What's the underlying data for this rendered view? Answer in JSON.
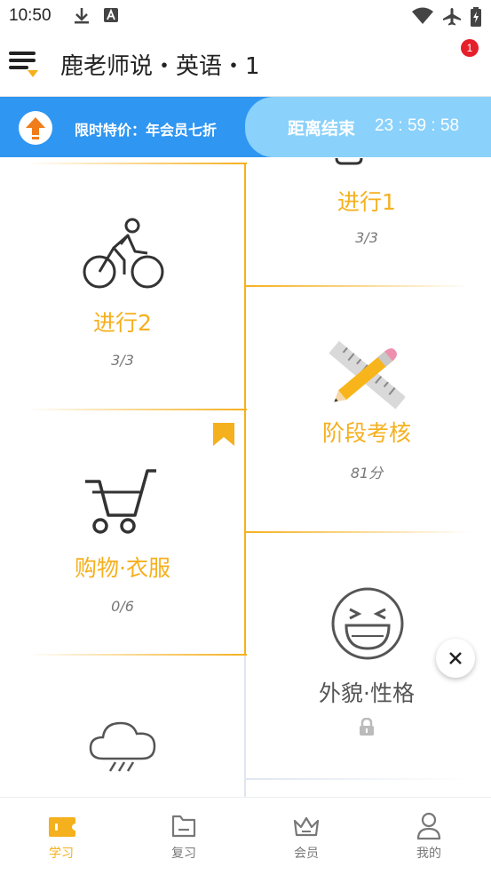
{
  "status_bar": {
    "time": "10:50"
  },
  "header": {
    "title": "鹿老师说・英语・1",
    "badge_count": "1"
  },
  "promo": {
    "label": "限时特价：年会员七折",
    "end_label": "距离结束",
    "countdown": "23 : 59 : 58"
  },
  "lessons": [
    {
      "title": "进行1",
      "progress": "3/3",
      "icon": "clipboard-icon",
      "state": "completed"
    },
    {
      "title": "进行2",
      "progress": "3/3",
      "icon": "bicycle-icon",
      "state": "completed"
    },
    {
      "title": "阶段考核",
      "progress": "81分",
      "icon": "pencil-ruler-icon",
      "state": "completed"
    },
    {
      "title": "购物·衣服",
      "progress": "0/6",
      "icon": "shopping-cart-icon",
      "state": "current",
      "bookmarked": true
    },
    {
      "title": "外貌·性格",
      "progress": "",
      "icon": "laughing-face-icon",
      "state": "locked"
    },
    {
      "title": "",
      "progress": "",
      "icon": "rain-cloud-icon",
      "state": "locked"
    }
  ],
  "tabs": [
    {
      "label": "学习",
      "icon": "ticket-icon",
      "active": true
    },
    {
      "label": "复习",
      "icon": "folder-icon",
      "active": false
    },
    {
      "label": "会员",
      "icon": "crown-icon",
      "active": false
    },
    {
      "label": "我的",
      "icon": "user-icon",
      "active": false
    }
  ],
  "colors": {
    "accent": "#f5b01e",
    "promo_blue": "#2f96f2",
    "promo_light": "#8ad1fb",
    "badge_red": "#e5202b",
    "locked_gray": "#666666"
  }
}
